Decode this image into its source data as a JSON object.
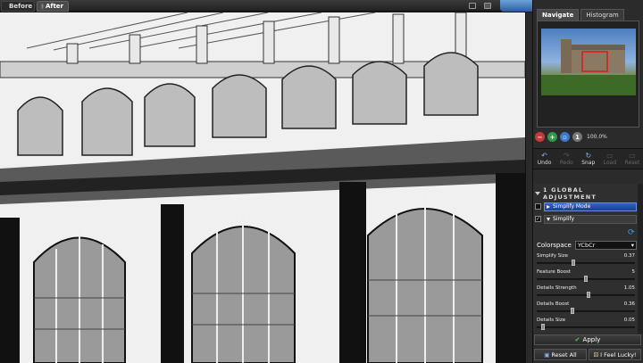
{
  "viewer": {
    "before_label": "Before",
    "after_label": "After"
  },
  "panel": {
    "tabs": [
      {
        "label": "Navigate",
        "active": true
      },
      {
        "label": "Histogram",
        "active": false
      }
    ],
    "zoom": "100.0%",
    "tools": [
      {
        "label": "Undo",
        "icon": "undo-arrow",
        "enabled": true
      },
      {
        "label": "Redo",
        "icon": "redo-arrow",
        "enabled": false
      },
      {
        "label": "Snap",
        "icon": "snap-arrow",
        "enabled": true
      },
      {
        "label": "Load",
        "icon": "load",
        "enabled": false
      },
      {
        "label": "Reset",
        "icon": "reset",
        "enabled": false
      }
    ]
  },
  "adjustments": {
    "header": "1 GLOBAL ADJUSTMENT",
    "mode_label": "Simplify Mode",
    "simplify_label": "Simplify",
    "colorspace_label": "Colorspace",
    "colorspace_value": "YCbCr",
    "sliders": [
      {
        "label": "Simplify Size",
        "value": "0.37",
        "fraction": 0.37
      },
      {
        "label": "Feature Boost",
        "value": "5",
        "fraction": 0.5
      },
      {
        "label": "Details Strength",
        "value": "1.05",
        "fraction": 0.53
      },
      {
        "label": "Details Boost",
        "value": "0.36",
        "fraction": 0.36
      },
      {
        "label": "Details Size",
        "value": "0.05",
        "fraction": 0.05
      }
    ]
  },
  "actions": {
    "apply_label": "Apply",
    "reset_all_label": "Reset All",
    "feel_lucky_label": "I Feel Lucky!"
  },
  "colors": {
    "accent_blue": "#2f63c8",
    "panel_bg": "#2b2b2b",
    "active_dot": "#3cc43c"
  }
}
